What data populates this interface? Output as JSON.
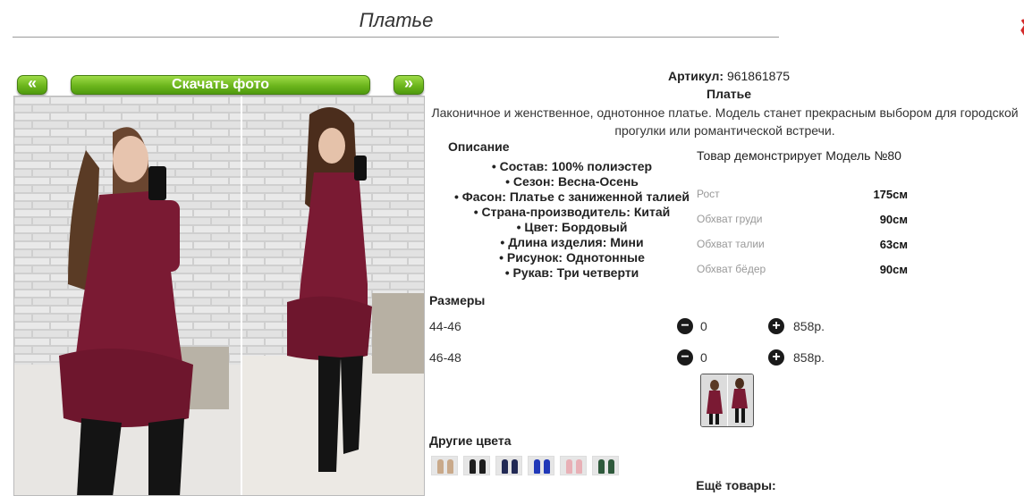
{
  "page": {
    "title": "Платье"
  },
  "gallery": {
    "prev_label": "«",
    "download_label": "Скачать фото",
    "next_label": "»"
  },
  "product": {
    "article_label": "Артикул:",
    "article_value": "961861875",
    "name": "Платье",
    "description_line1": "Лаконичное и женственное, однотонное платье. Модель станет прекрасным выбором для городской",
    "description_line2": "прогулки или романтической встречи."
  },
  "description": {
    "heading": "Описание",
    "items": [
      "• Состав: 100% полиэстер",
      "• Сезон: Весна-Осень",
      "• Фасон: Платье с заниженной талией",
      "• Страна-производитель: Китай",
      "• Цвет: Бордовый",
      "• Длина изделия: Мини",
      "• Рисунок: Однотонные",
      "• Рукав: Три четверти"
    ]
  },
  "model": {
    "line": "Товар демонстрирует Модель №80",
    "measurements": [
      {
        "label": "Рост",
        "value": "175см"
      },
      {
        "label": "Обхват груди",
        "value": "90см"
      },
      {
        "label": "Обхват талии",
        "value": "63см"
      },
      {
        "label": "Обхват бёдер",
        "value": "90см"
      }
    ]
  },
  "sizes": {
    "heading": "Размеры",
    "rows": [
      {
        "label": "44-46",
        "minus": "−",
        "qty": "0",
        "plus": "+",
        "price": "858р."
      },
      {
        "label": "46-48",
        "minus": "−",
        "qty": "0",
        "plus": "+",
        "price": "858р."
      }
    ]
  },
  "other_colors": {
    "heading": "Другие цвета",
    "swatch_colors": [
      "#c9a98a",
      "#1d1d1d",
      "#222a55",
      "#2038b8",
      "#e8b0b6",
      "#2f5a3c"
    ]
  },
  "more_products": {
    "label": "Ещё товары:"
  },
  "colors": {
    "accent_green": "#6cb51d",
    "dress": "#7a1a33"
  }
}
